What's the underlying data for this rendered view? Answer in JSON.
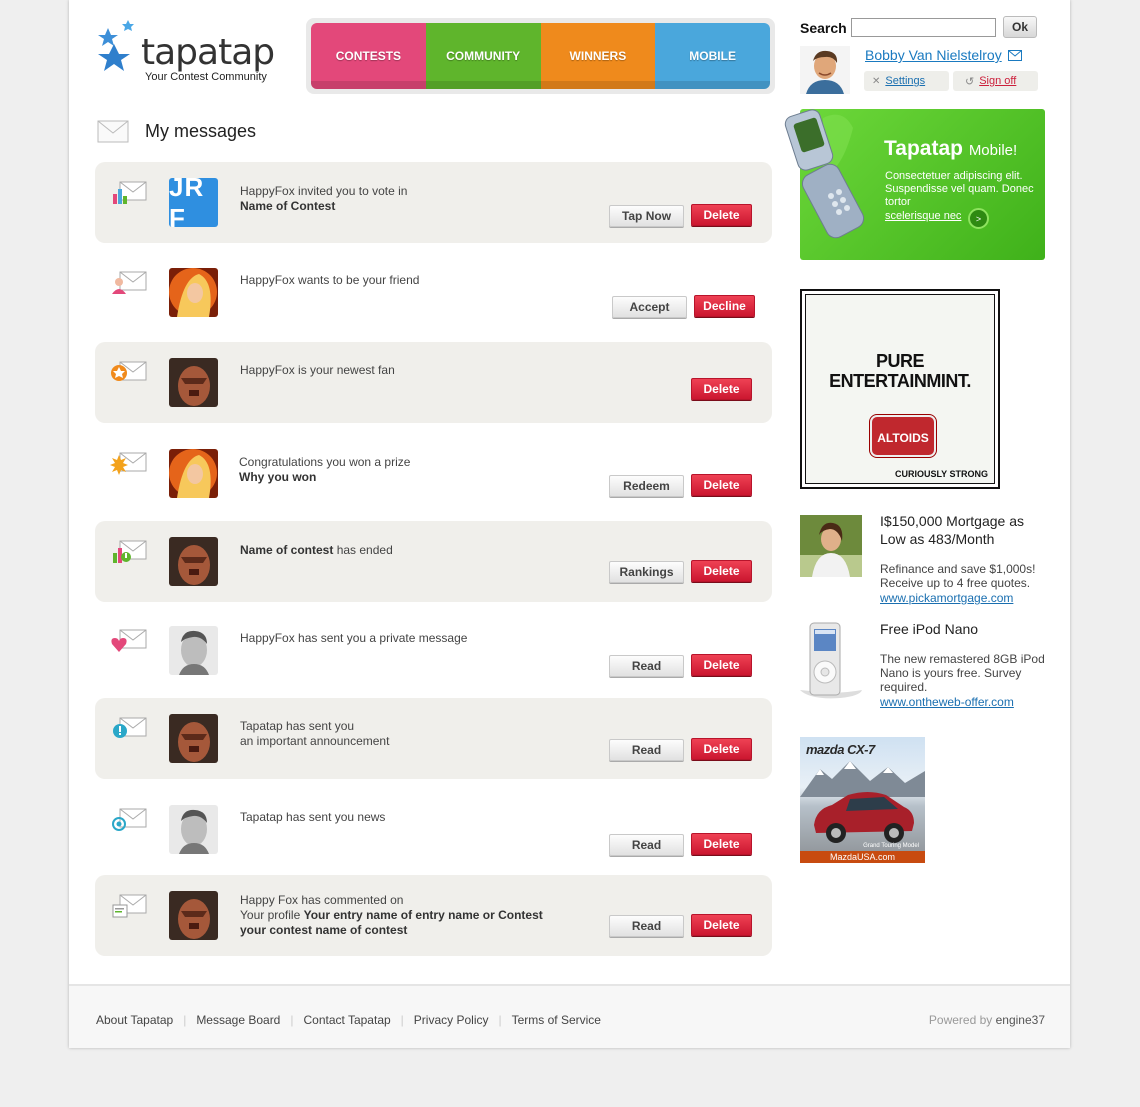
{
  "brand": {
    "name": "tapatap",
    "tagline": "Your Contest Community"
  },
  "nav": {
    "tabs": [
      {
        "label": "CONTESTS",
        "color": "#e3487a"
      },
      {
        "label": "COMMUNITY",
        "color": "#5fb52c"
      },
      {
        "label": "WINNERS",
        "color": "#ef8a1c"
      },
      {
        "label": "MOBILE",
        "color": "#4aa7dc"
      }
    ]
  },
  "search": {
    "label": "Search",
    "value": "",
    "button": "Ok"
  },
  "user": {
    "name": "Bobby Van Nielstelroy",
    "settings": "Settings",
    "signoff": "Sign off"
  },
  "page": {
    "title": "My messages"
  },
  "messages": [
    {
      "line1": "HappyFox invited you to vote in",
      "line2": "Name of Contest",
      "action": "Tap Now",
      "secondary": "Delete",
      "avatar_text": "JR F"
    },
    {
      "line1": "HappyFox wants to be your friend",
      "action": "Accept",
      "secondary": "Decline"
    },
    {
      "line1": "HappyFox is your newest fan",
      "secondary": "Delete"
    },
    {
      "line1": "Congratulations you won a prize",
      "line2": "Why you won",
      "action": "Redeem",
      "secondary": "Delete"
    },
    {
      "bold": "Name of contest",
      "line1": " has ended",
      "action": "Rankings",
      "secondary": "Delete"
    },
    {
      "line1": "HappyFox has sent you a private message",
      "action": "Read",
      "secondary": "Delete"
    },
    {
      "line1": "Tapatap has sent you",
      "line2": "an important announcement",
      "action": "Read",
      "secondary": "Delete"
    },
    {
      "line1": "Tapatap has sent you news",
      "action": "Read",
      "secondary": "Delete"
    },
    {
      "line1": "Happy Fox has commented on",
      "line2_prefix": "Your profile ",
      "line2_bold": "Your entry name of  entry name or Contest",
      "line3": "your contest name of contest",
      "action": "Read",
      "secondary": "Delete"
    }
  ],
  "promo": {
    "title": "Tapatap",
    "title_suffix": "Mobile!",
    "text": "Consectetuer adipiscing elit. Suspendisse vel quam. Donec tortor",
    "link": "scelerisque nec"
  },
  "ads": {
    "altoids": {
      "headline_1": "PURE",
      "headline_2": "ENTERTAINMINT.",
      "brand": "ALTOIDS",
      "tagline": "CURIOUSLY STRONG"
    },
    "mortgage": {
      "title": "I$150,000 Mortgage as Low as 483/Month",
      "body": "Refinance and save $1,000s! Receive up to 4 free quotes.",
      "link": "www.pickamortgage.com"
    },
    "ipod": {
      "title": "Free iPod Nano",
      "body": "The new remastered 8GB iPod Nano is yours free. Survey required.",
      "link": "www.ontheweb-offer.com"
    },
    "mazda": {
      "logo": "mazda CX-7",
      "model": "Grand Touring Model",
      "url": "MazdaUSA.com"
    }
  },
  "footer": {
    "links": [
      "About Tapatap",
      "Message Board",
      "Contact Tapatap",
      "Privacy Policy",
      "Terms of Service"
    ],
    "powered_prefix": "Powered by",
    "powered_name": "engine37"
  }
}
